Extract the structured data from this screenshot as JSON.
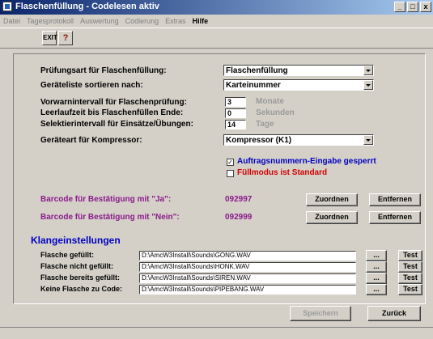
{
  "window": {
    "title": "Flaschenfüllung  -  Codelesen aktiv",
    "controls": [
      "_",
      "□",
      "x"
    ]
  },
  "menu": [
    "Datei",
    "Tagesprotokoll",
    "Auswertung",
    "Codierung",
    "Extras",
    "Hilfe"
  ],
  "toolbar": {
    "exit_label": "EXIT",
    "help_glyph": "?"
  },
  "form": {
    "pruefungsart_label": "Prüfungsart für Flaschenfüllung:",
    "pruefungsart_value": "Flaschenfüllung",
    "sortieren_label": "Geräteliste sortieren nach:",
    "sortieren_value": "Karteinummer",
    "vorwarn_label": "Vorwarnintervall für Flaschenprüfung:",
    "vorwarn_value": "3",
    "vorwarn_unit": "Monate",
    "leerlauf_label": "Leerlaufzeit bis Flaschenfüllen Ende:",
    "leerlauf_value": "0",
    "leerlauf_unit": "Sekunden",
    "selektier_label": "Selektierintervall für Einsätze/Übungen:",
    "selektier_value": "14",
    "selektier_unit": "Tage",
    "kompressor_label": "Geräteart für Kompressor:",
    "kompressor_value": "Kompressor (K1)",
    "checkbox1_label": "Auftragsnummern-Eingabe gesperrt",
    "checkbox1_checked": "✓",
    "checkbox2_label": "Füllmodus ist Standard"
  },
  "barcodes": {
    "ja_label": "Barcode für Bestätigung mit \"Ja\":",
    "ja_value": "092997",
    "nein_label": "Barcode für Bestätigung mit \"Nein\":",
    "nein_value": "092999",
    "assign_label": "Zuordnen",
    "remove_label": "Entfernen"
  },
  "sounds": {
    "heading": "Klangeinstellungen",
    "browse_label": "...",
    "test_label": "Test",
    "rows": [
      {
        "label": "Flasche gefüllt:",
        "path": "D:\\AmcW3Install\\Sounds\\GONG.WAV"
      },
      {
        "label": "Flasche nicht gefüllt:",
        "path": "D:\\AmcW3Install\\Sounds\\HONK.WAV"
      },
      {
        "label": "Flasche bereits gefüllt:",
        "path": "D:\\AmcW3Install\\Sounds\\SIREN.WAV"
      },
      {
        "label": "Keine Flasche zu Code:",
        "path": "D:\\AmcW3Install\\Sounds\\PIPEBANG.WAV"
      }
    ]
  },
  "actions": {
    "save_label": "Speichern",
    "back_label": "Zurück"
  },
  "colors": {
    "title_start": "#0a246a",
    "title_end": "#a6caf0",
    "purple": "#8b1a8b",
    "blue": "#0000c0",
    "red": "#d00000",
    "face": "#d4d0c8"
  }
}
